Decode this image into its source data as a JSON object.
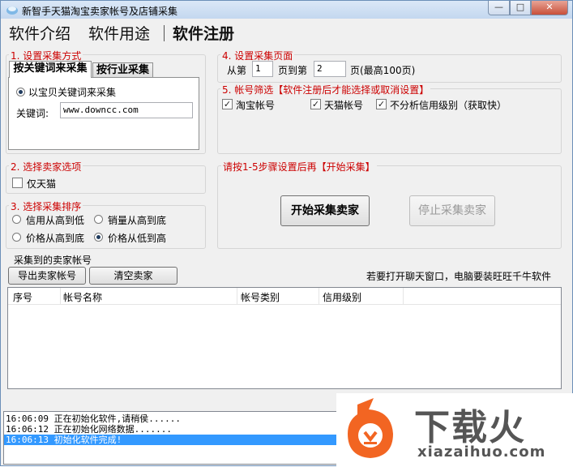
{
  "window": {
    "title": "新智手天猫淘宝卖家帐号及店铺采集"
  },
  "menu": {
    "intro": "软件介绍",
    "usage": "软件用途",
    "register": "软件注册"
  },
  "section1": {
    "label": "1. 设置采集方式",
    "tabs": [
      "按关键词来采集",
      "按行业采集"
    ],
    "radio_label": "以宝贝关键词来采集",
    "keyword_label": "关键词:",
    "keyword_value": "www.downcc.com"
  },
  "section2": {
    "label": "2. 选择卖家选项",
    "tmall_only": "仅天猫"
  },
  "section3": {
    "label": "3. 选择采集排序",
    "options": [
      "信用从高到低",
      "销量从高到底",
      "价格从高到底",
      "价格从低到高"
    ],
    "selected": "价格从低到高"
  },
  "section4": {
    "label": "4. 设置采集页面",
    "from": "从第",
    "from_value": "1",
    "to": "页到第",
    "to_value": "2",
    "suffix": "页(最高100页)"
  },
  "section5": {
    "label": "5. 帐号筛选【软件注册后才能选择或取消设置】",
    "options": [
      "淘宝帐号",
      "天猫帐号",
      "不分析信用级别（获取快）"
    ]
  },
  "start_section": {
    "label": "请按1-5步骤设置后再【开始采集】",
    "start_button": "开始采集卖家",
    "stop_button": "停止采集卖家"
  },
  "results": {
    "label": "采集到的卖家帐号",
    "export_button": "导出卖家帐号",
    "clear_button": "清空卖家",
    "hint": "若要打开聊天窗口，电脑要装旺旺千牛软件",
    "columns": [
      "序号",
      "帐号名称",
      "帐号类别",
      "信用级别"
    ]
  },
  "log": [
    "16:06:09 正在初始化软件,请稍侯......",
    "16:06:12 正在初始化网络数据.......",
    "16:06:13 初始化软件完成!"
  ],
  "watermark": {
    "logo": "下载火",
    "domain": "xiazaihuo.com"
  },
  "colors": {
    "accent_red": "#cc0000",
    "selection": "#3399ff",
    "watermark_orange": "#f26522",
    "watermark_dark": "#555555"
  }
}
